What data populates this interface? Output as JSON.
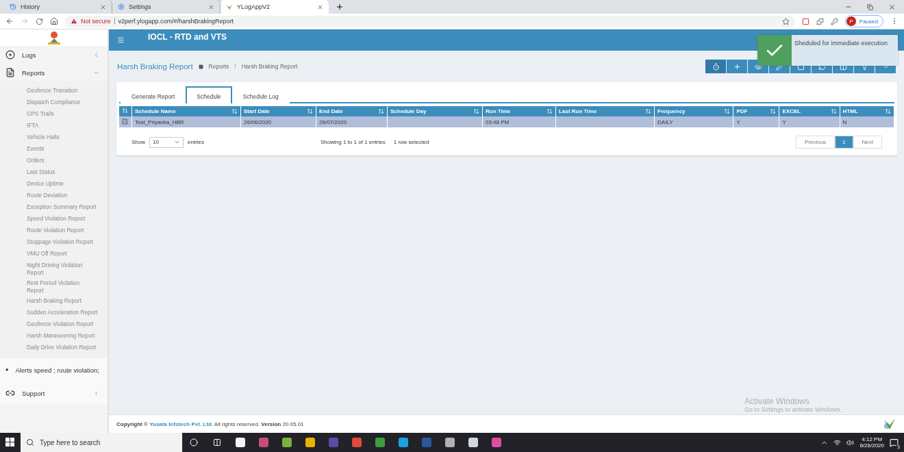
{
  "browser": {
    "tabs": [
      {
        "title": "History",
        "kind": "history",
        "selected": false
      },
      {
        "title": "Settings",
        "kind": "settings",
        "selected": false
      },
      {
        "title": "YLogAppV2",
        "kind": "app",
        "selected": true
      }
    ],
    "address": {
      "warning": "Not secure",
      "url": "v2perf.ylogapp.com/#/harshBrakingReport"
    },
    "profile": {
      "initial": "P",
      "label": "Paused"
    }
  },
  "header": {
    "title": "IOCL - RTD and VTS"
  },
  "toast": {
    "message": "Sheduled for immediate execution"
  },
  "sidebar": {
    "items": [
      {
        "label": "Logs",
        "kind": "logs",
        "expanded": false
      },
      {
        "label": "Reports",
        "kind": "reports",
        "expanded": true,
        "children": [
          {
            "label": "Geofence Transition",
            "selected": false
          },
          {
            "label": "Dispatch Compliance",
            "selected": false
          },
          {
            "label": "GPS Trails",
            "selected": false
          },
          {
            "label": "IFTA",
            "selected": false
          },
          {
            "label": "Vehicle Halts",
            "selected": false
          },
          {
            "label": "Events",
            "selected": false
          },
          {
            "label": "Orders",
            "selected": false
          },
          {
            "label": "Last Status",
            "selected": false
          },
          {
            "label": "Device Uptime",
            "selected": false
          },
          {
            "label": "Route Deviation",
            "selected": false
          },
          {
            "label": "Exception Summary Report",
            "selected": false
          },
          {
            "label": "Speed Violation Report",
            "selected": false
          },
          {
            "label": "Route Violation Report",
            "selected": false
          },
          {
            "label": "Stoppage Violation Report",
            "selected": false
          },
          {
            "label": "VMU Off Report",
            "selected": false
          },
          {
            "label": "Night Driving Violation Report",
            "selected": false
          },
          {
            "label": "Rest Period Violation Report",
            "selected": false
          },
          {
            "label": "Harsh Braking Report",
            "selected": false
          },
          {
            "label": "Sudden Acceleration Report",
            "selected": false
          },
          {
            "label": "Geofence Violation Report",
            "selected": false
          },
          {
            "label": "Harsh Maneuvering Report",
            "selected": false
          },
          {
            "label": "Daily Drive Violation Report",
            "selected": false
          }
        ]
      },
      {
        "label": "Alerts speed ; route violation;",
        "kind": "alerts"
      },
      {
        "label": "Support",
        "kind": "support",
        "expanded": false
      }
    ]
  },
  "page": {
    "title": "Harsh Braking Report",
    "breadcrumb": [
      "Reports",
      "Harsh Braking Report"
    ],
    "separator": "/"
  },
  "tabs": [
    {
      "label": "Generate Report",
      "selected": false
    },
    {
      "label": "Schedule",
      "selected": true
    },
    {
      "label": "Schedule Log",
      "selected": false
    }
  ],
  "table": {
    "columns": [
      "Schedule Name",
      "Start Date",
      "End Date",
      "Schedule Day",
      "Run Time",
      "Last Run Time",
      "Frequency",
      "PDF",
      "EXCEL",
      "HTML"
    ],
    "rows": [
      {
        "selected": true,
        "cells": [
          "Test_Priyanka_HBR",
          "26/06/2020",
          "26/07/2020",
          "",
          "03:48 PM",
          "",
          "DAILY",
          "Y",
          "Y",
          "N"
        ]
      }
    ]
  },
  "length": {
    "before": "Show",
    "value": "10",
    "after": "entries"
  },
  "info": "Showing 1 to 1 of 1 entries",
  "selection_info": "1 row selected",
  "pagination": [
    {
      "label": "Previous",
      "selected": false
    },
    {
      "label": "1",
      "selected": true
    },
    {
      "label": "Next",
      "selected": false
    }
  ],
  "os_notice": {
    "title": "Activate Windows",
    "detail": "Go to Settings to activate Windows."
  },
  "footer": {
    "label": "Copyright ©",
    "company": "Yusata Infotech Pvt. Ltd.",
    "rest": "All rights reserved. **Version** 20.05.01"
  },
  "taskbar": {
    "search_placeholder": "Type here to search",
    "time": "4:12 PM",
    "date": "6/26/2020",
    "notifications": "3"
  }
}
